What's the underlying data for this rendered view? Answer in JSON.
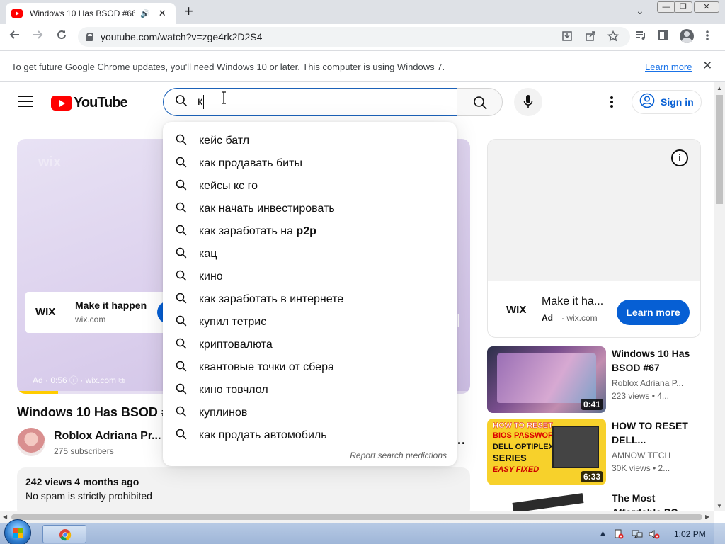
{
  "browser": {
    "tab_title": "Windows 10 Has BSOD #66",
    "tab_audio": "🔊",
    "tab_close": "✕",
    "new_tab": "+",
    "strip_chevron": "⌄",
    "minimize": "—",
    "restore": "❐",
    "close": "✕",
    "url": "youtube.com/watch?v=zge4rk2D2S4"
  },
  "infobar": {
    "message": "To get future Google Chrome updates, you'll need Windows 10 or later. This computer is using Windows 7.",
    "link": "Learn more",
    "close": "✕"
  },
  "header": {
    "logo_text": "YouTube",
    "search_value": "к",
    "sign_in": "Sign in"
  },
  "suggestions": {
    "items": [
      {
        "text": "кейс батл",
        "bold": ""
      },
      {
        "text": "как продавать биты",
        "bold": ""
      },
      {
        "text": "кейсы кс го",
        "bold": ""
      },
      {
        "text": "как начать инвестировать",
        "bold": ""
      },
      {
        "text": "как заработать на ",
        "bold": "p2p"
      },
      {
        "text": "кац",
        "bold": ""
      },
      {
        "text": "кино",
        "bold": ""
      },
      {
        "text": "как заработать в интернете",
        "bold": ""
      },
      {
        "text": "купил тетрис",
        "bold": ""
      },
      {
        "text": "криптовалюта",
        "bold": ""
      },
      {
        "text": "квантовые точки от сбера",
        "bold": ""
      },
      {
        "text": "кино товчлол",
        "bold": ""
      },
      {
        "text": "куплинов",
        "bold": ""
      },
      {
        "text": "как продать автомобиль",
        "bold": ""
      }
    ],
    "report": "Report search predictions"
  },
  "player": {
    "ghost_logo": "wix",
    "ad_logo": "WIX",
    "ad_title": "Make it happen",
    "ad_domain": "wix.com",
    "ad_info": "Ad · 0:56  ⓘ  · wix.com ⧉",
    "skip": "▸|",
    "ad_progress": 0.09
  },
  "video": {
    "title": "Windows 10 Has BSOD #",
    "channel": "Roblox Adriana Pr...",
    "subscribers": "275 subscribers",
    "more": "···",
    "meta": "242 views  4 months ago",
    "description": "No spam is strictly prohibited"
  },
  "side_ad": {
    "info": "i",
    "logo": "WIX",
    "title": "Make it ha...",
    "ad_label": "Ad",
    "domain": "· wix.com",
    "cta": "Learn more"
  },
  "recommendations": [
    {
      "title": "Windows 10 Has BSOD #67",
      "channel": "Roblox Adriana P...",
      "stats": "223 views  •  4...",
      "duration": "0:41"
    },
    {
      "title": "HOW TO RESET DELL...",
      "channel": "AMNOW TECH",
      "stats": "30K views  •  2...",
      "duration": "6:33",
      "thumb_text": [
        "HOW TO RESET",
        "BIOS PASSWORD",
        "DELL OPTIPLEX",
        "SERIES",
        "EASY FIXED"
      ]
    },
    {
      "title": "The Most Affordable PC...",
      "channel": "",
      "stats": "",
      "duration": ""
    }
  ],
  "taskbar": {
    "clock": "1:02 PM",
    "tray_up": "▲"
  },
  "colors": {
    "youtube_red": "#ff0000",
    "link_blue": "#065fd4",
    "focus_blue": "#1c62b9"
  }
}
